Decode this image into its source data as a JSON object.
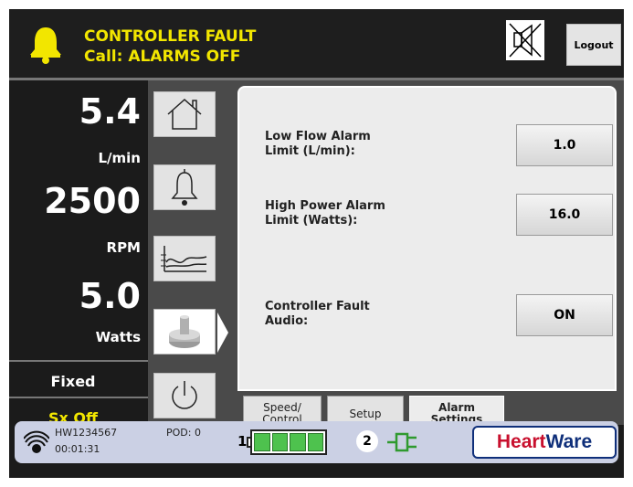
{
  "alarm": {
    "title": "CONTROLLER FAULT",
    "call": "Call: ALARMS OFF",
    "color": "#f2e600"
  },
  "header": {
    "logout_label": "Logout",
    "mute_icon": "speaker-muted-icon"
  },
  "readings": {
    "flow_value": "5.4",
    "flow_unit": "L/min",
    "speed_value": "2500",
    "speed_unit": "RPM",
    "power_value": "5.0",
    "power_unit": "Watts",
    "mode": "Fixed",
    "suction": "Sx Off"
  },
  "nav": {
    "items": [
      "home-icon",
      "bell-icon",
      "waveform-icon",
      "pump-image",
      "power-icon"
    ],
    "active": "pump-image"
  },
  "settings": {
    "low_flow_label_1": "Low Flow Alarm",
    "low_flow_label_2": "Limit (L/min):",
    "low_flow_value": "1.0",
    "high_power_label_1": "High Power Alarm",
    "high_power_label_2": "Limit (Watts):",
    "high_power_value": "16.0",
    "fault_audio_label_1": "Controller Fault",
    "fault_audio_label_2": "Audio:",
    "fault_audio_value": "ON"
  },
  "tabs": {
    "speed_1": "Speed/",
    "speed_2": "Control",
    "setup": "Setup",
    "alarm_1": "Alarm",
    "alarm_2": "Settings",
    "active": "Alarm Settings"
  },
  "footer": {
    "serial": "HW1234567",
    "time": "00:01:31",
    "pod": "POD:  0",
    "battery_1_label": "1",
    "battery_1_cells": 4,
    "power_2_label": "2",
    "brand_part1": "Heart",
    "brand_part2": "Ware"
  }
}
